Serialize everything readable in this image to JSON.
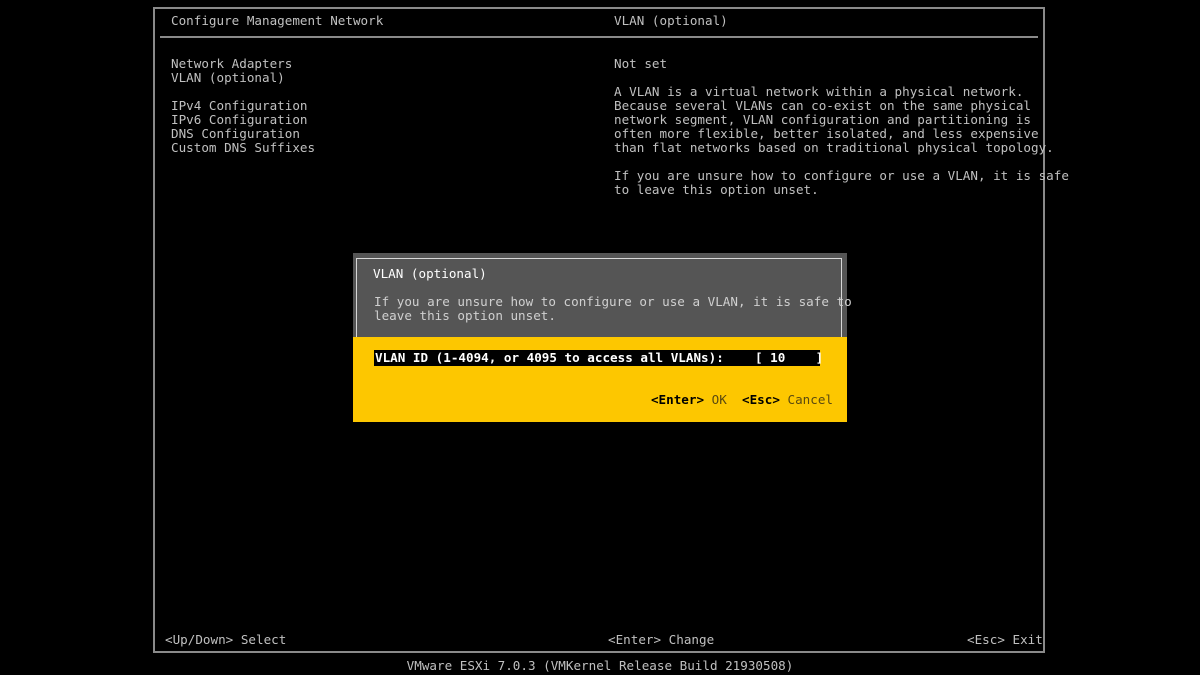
{
  "header": {
    "left_title": "Configure Management Network",
    "right_title": "VLAN (optional)"
  },
  "menu": {
    "items": [
      {
        "label": "Network Adapters"
      },
      {
        "label": "VLAN (optional)"
      },
      {
        "label": "IPv4 Configuration"
      },
      {
        "label": "IPv6 Configuration"
      },
      {
        "label": "DNS Configuration"
      },
      {
        "label": "Custom DNS Suffixes"
      }
    ]
  },
  "details": {
    "status": "Not set",
    "paragraph1": "A VLAN is a virtual network within a physical network.\nBecause several VLANs can co-exist on the same physical\nnetwork segment, VLAN configuration and partitioning is\noften more flexible, better isolated, and less expensive\nthan flat networks based on traditional physical topology.",
    "paragraph2": "If you are unsure how to configure or use a VLAN, it is safe\nto leave this option unset."
  },
  "dialog": {
    "title": "VLAN (optional)",
    "message": "If you are unsure how to configure or use a VLAN, it is safe to\nleave this option unset.",
    "field_label": "VLAN ID (1-4094, or 4095 to access all VLANs):",
    "field_value": "[ 10    ]",
    "ok_key": "<Enter>",
    "ok_label": "OK",
    "cancel_key": "<Esc>",
    "cancel_label": "Cancel"
  },
  "footer": {
    "left": "<Up/Down> Select",
    "center": "<Enter> Change",
    "right": "<Esc> Exit"
  },
  "version": "VMware ESXi 7.0.3 (VMKernel Release Build 21930508)",
  "colors": {
    "background": "#000000",
    "dialog_accent": "#fdc700",
    "dialog_header": "#555555",
    "text": "#c0c0c0"
  }
}
